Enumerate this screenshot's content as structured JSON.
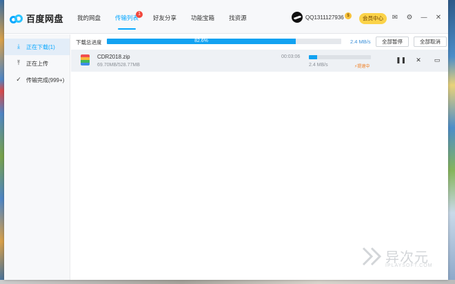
{
  "app": {
    "name": "百度网盘"
  },
  "nav": {
    "tabs": [
      {
        "label": "我的网盘"
      },
      {
        "label": "传输列表",
        "badge": "1"
      },
      {
        "label": "好友分享"
      },
      {
        "label": "功能宝箱"
      },
      {
        "label": "找资源"
      }
    ]
  },
  "user": {
    "name": "QQ1311127936",
    "vip_badge": "$",
    "member_label": "会员中心"
  },
  "sidebar": {
    "items": [
      {
        "label": "正在下载(1)",
        "icon": "download-icon"
      },
      {
        "label": "正在上传",
        "icon": "upload-icon"
      },
      {
        "label": "传输完成(999+)",
        "icon": "check-circle-icon"
      }
    ]
  },
  "summary": {
    "label": "下载总进度",
    "progress": 0.806,
    "progress_text": "82.6%",
    "speed": "2.4 MB/s",
    "pause_all": "全部暂停",
    "cancel_all": "全部取消"
  },
  "downloads": [
    {
      "name": "CDR2018.zip",
      "size": "69.70MB/528.77MB",
      "time_left": "00:03:06",
      "progress": 0.13,
      "speed": "2.4 MB/s",
      "accel_label": "提速中"
    }
  ],
  "watermark": {
    "cn": "异次元",
    "en": "IPLAYSOFT.COM"
  },
  "colors": {
    "accent": "#06a7ff",
    "progress": "#12a2f1",
    "vip": "#fbd349",
    "badge": "#f2473c",
    "accel": "#f07a1a"
  }
}
